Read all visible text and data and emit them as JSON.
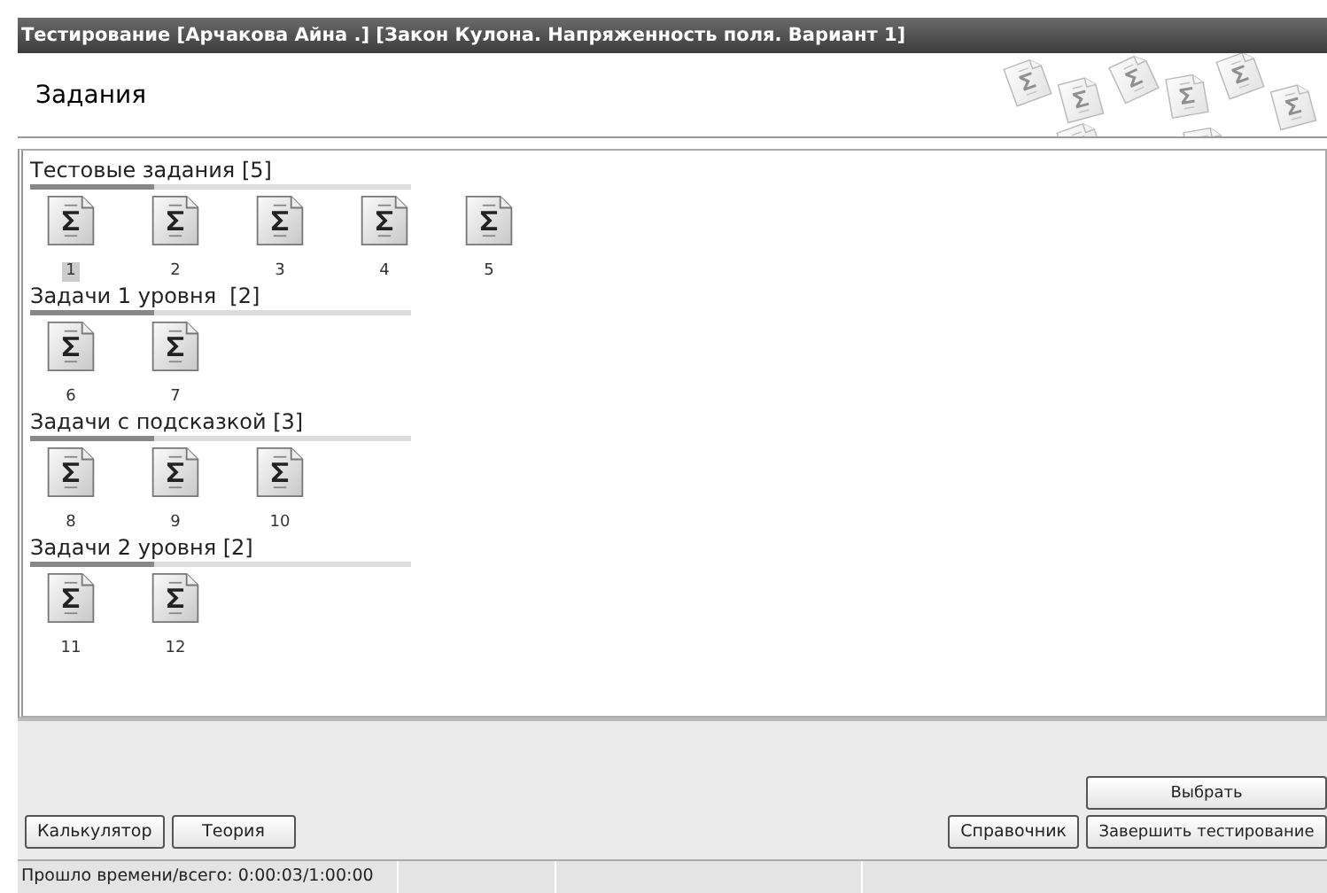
{
  "window": {
    "title": "Тестирование [Арчакова Айна .] [Закон Кулона. Напряженность поля. Вариант 1]"
  },
  "header": {
    "title": "Задания"
  },
  "groups": [
    {
      "title": "Тестовые задания [5]",
      "tasks": [
        {
          "label": "1",
          "selected": true
        },
        {
          "label": "2",
          "selected": false
        },
        {
          "label": "3",
          "selected": false
        },
        {
          "label": "4",
          "selected": false
        },
        {
          "label": "5",
          "selected": false
        }
      ]
    },
    {
      "title": "Задачи 1 уровня  [2]",
      "tasks": [
        {
          "label": "6",
          "selected": false
        },
        {
          "label": "7",
          "selected": false
        }
      ]
    },
    {
      "title": "Задачи с подсказкой [3]",
      "tasks": [
        {
          "label": "8",
          "selected": false
        },
        {
          "label": "9",
          "selected": false
        },
        {
          "label": "10",
          "selected": false
        }
      ]
    },
    {
      "title": "Задачи 2 уровня [2]",
      "tasks": [
        {
          "label": "11",
          "selected": false
        },
        {
          "label": "12",
          "selected": false
        }
      ]
    }
  ],
  "buttons_left": [
    "Калькулятор",
    "Теория"
  ],
  "select_button": "Выбрать",
  "buttons_right": [
    "Справочник",
    "Завершить тестирование"
  ],
  "status_bar": {
    "elapsed": "Прошло времени/всего: 0:00:03/1:00:00"
  }
}
